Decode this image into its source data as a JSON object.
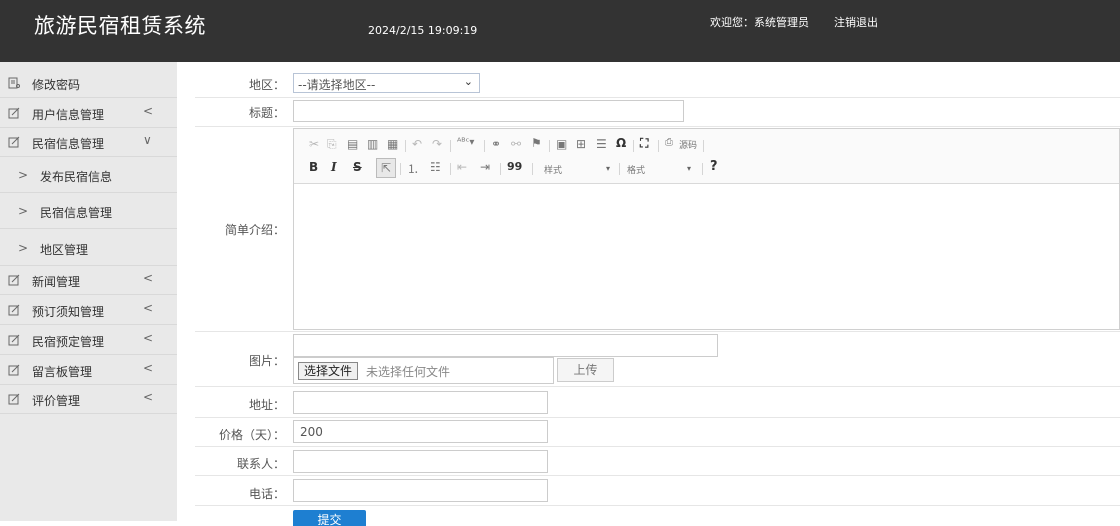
{
  "header": {
    "title": "旅游民宿租赁系统",
    "datetime": "2024/2/15 19:09:19",
    "welcome": "欢迎您：系统管理员",
    "logout": "注销退出"
  },
  "sidebar": {
    "items": [
      {
        "label": "修改密码",
        "icon": "key-icon"
      },
      {
        "label": "用户信息管理",
        "icon": "edit-icon",
        "chevron": "<"
      },
      {
        "label": "民宿信息管理",
        "icon": "edit-icon",
        "chevron": "v"
      },
      {
        "label": "发布民宿信息"
      },
      {
        "label": "民宿信息管理"
      },
      {
        "label": "地区管理"
      },
      {
        "label": "新闻管理",
        "icon": "edit-icon",
        "chevron": "<"
      },
      {
        "label": "预订须知管理",
        "icon": "edit-icon",
        "chevron": "<"
      },
      {
        "label": "民宿预定管理",
        "icon": "edit-icon",
        "chevron": "<"
      },
      {
        "label": "留言板管理",
        "icon": "edit-icon",
        "chevron": "<"
      },
      {
        "label": "评价管理",
        "icon": "edit-icon",
        "chevron": "<"
      }
    ],
    "sub_arrow": ">",
    "chevron_left": "<",
    "chevron_down": "∨"
  },
  "form": {
    "region_label": "地区：",
    "region_value": "--请选择地区--",
    "title_label": "标题：",
    "title_value": "",
    "intro_label": "简单介绍：",
    "image_label": "图片：",
    "image_path_value": "",
    "file_button": "选择文件",
    "file_none": "未选择任何文件",
    "upload_button": "上传",
    "address_label": "地址：",
    "address_value": "",
    "price_label": "价格（天）：",
    "price_value": "200",
    "contact_label": "联系人：",
    "contact_value": "",
    "phone_label": "电话：",
    "phone_value": "",
    "submit_button": "提交"
  },
  "editor": {
    "source_label": "源码",
    "style_combo": "样式",
    "format_combo": "格式",
    "help": "?",
    "bold": "B",
    "italic": "I",
    "strike": "S",
    "quote": "99",
    "special_char": "Ω"
  }
}
